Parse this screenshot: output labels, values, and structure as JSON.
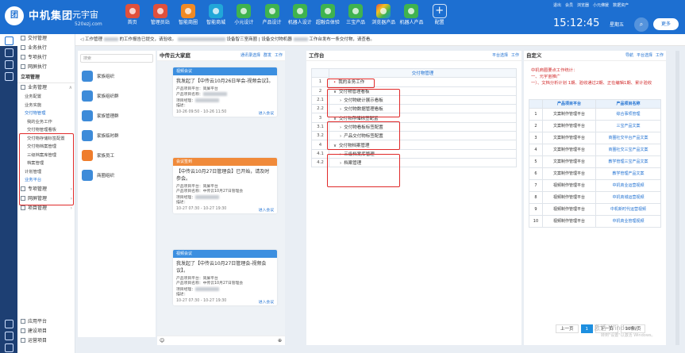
{
  "brand": {
    "logo_char": "团",
    "name": "中机集团",
    "product": "元宇宙",
    "site": "520ezj.com"
  },
  "nav": [
    {
      "label": "首页",
      "icon": "home-icon",
      "color": "red"
    },
    {
      "label": "管理员站",
      "icon": "admin-icon",
      "color": "red"
    },
    {
      "label": "智能商圈",
      "icon": "shop-icon",
      "color": "orange"
    },
    {
      "label": "智能商城",
      "icon": "cart-icon",
      "color": "cyan"
    },
    {
      "label": "小元设计",
      "icon": "design-icon",
      "color": "green"
    },
    {
      "label": "产品设计",
      "icon": "product-icon",
      "color": "green"
    },
    {
      "label": "机器人设计",
      "icon": "robot-icon",
      "color": "green"
    },
    {
      "label": "超融合体验",
      "icon": "fusion-icon",
      "color": "green"
    },
    {
      "label": "三宝产品",
      "icon": "product-icon",
      "color": "green"
    },
    {
      "label": "浏览器产品",
      "icon": "browser-icon",
      "color": "rainbow"
    },
    {
      "label": "机器人产品",
      "icon": "robot-icon",
      "color": "green"
    },
    {
      "label": "配置",
      "icon": "plus-icon",
      "color": "plus"
    }
  ],
  "top_links": [
    "退出",
    "会员",
    "浏览器",
    "小元佛媛",
    "数据资产"
  ],
  "clock": "15:12:45",
  "weekday": "星期五",
  "more": "更多",
  "notice": {
    "t1": "工作管理",
    "t2": "的工作报告已提交，请验收。",
    "t3": "设备智三室商圈 | 设备交付物机器",
    "t4": "工作台发布一条交付物，请查看。"
  },
  "sidebar": {
    "items_top": [
      {
        "label": "交付管理",
        "icon": "deliver-icon"
      },
      {
        "label": "业务执行",
        "icon": "task-icon"
      },
      {
        "label": "专项执行",
        "icon": "special-icon"
      },
      {
        "label": "网屏执行",
        "icon": "screen-icon"
      }
    ],
    "section": "立项管理",
    "group_label": "业务管理",
    "subs_a": [
      "业务配置",
      "业务实施"
    ],
    "deliver_group": "交付物管理",
    "deliver_subs": [
      "我的业务工作",
      "交付物管理看板",
      "交付物存储标签配置",
      "交付物档案管理",
      "三级档案库管理",
      "档案管理"
    ],
    "subs_b": [
      "计划管理",
      "业务平台"
    ],
    "items_mid": [
      {
        "label": "专项管理"
      },
      {
        "label": "网屏管理"
      },
      {
        "label": "项目管理"
      }
    ],
    "items_bottom": [
      {
        "label": "应用平台"
      },
      {
        "label": "建设项目"
      },
      {
        "label": "运营项目"
      }
    ]
  },
  "contacts": {
    "search_placeholder": "搜索",
    "items": [
      {
        "name": "家族组织",
        "c": "b"
      },
      {
        "name": "家族组织群",
        "c": "b"
      },
      {
        "name": "家族管理群",
        "c": "b"
      },
      {
        "name": "家族临时群",
        "c": "b"
      },
      {
        "name": "家族员工",
        "c": "o"
      },
      {
        "name": "商圈组织",
        "c": "b"
      }
    ]
  },
  "chat": {
    "title": "中传云大家庭",
    "tools": [
      "通讯录选择",
      "群发",
      "工作"
    ],
    "cards": [
      {
        "type": "视频会议",
        "text": "我发起了【中传云10月26日早会-视频会议】。",
        "p1": "产品项目平台：",
        "p1v": "简屏平台",
        "p2": "产品项目名称：",
        "p2v": "",
        "p3": "项目经理：",
        "p3v": "",
        "p4": "描述：",
        "time": "10-26 09:50 - 10-26 11:50",
        "link": "进入会议",
        "color": "blue"
      },
      {
        "type": "会议签到",
        "text": "【中传云10月27日管理会】已开始，请及时参会。",
        "p1": "产品项目平台：",
        "p1v": "简屏平台",
        "p2": "产品项目名称：",
        "p2v": "中传云10月27日管理会",
        "p3": "项目经理：",
        "p3v": "",
        "p4": "描述：",
        "time": "10-27 07:30 - 10-27 19:30",
        "link": "进入会议",
        "color": "orange"
      },
      {
        "type": "视频会议",
        "text": "我发起了【中传云10月27日管理会-视频会议】。",
        "p1": "产品项目平台：",
        "p1v": "简屏平台",
        "p2": "产品项目名称：",
        "p2v": "中传云10月27日管理会",
        "p3": "项目经理：",
        "p3v": "",
        "p4": "描述：",
        "time": "10-27 07:30 - 10-27 19:30",
        "link": "进入会议",
        "color": "blue"
      }
    ]
  },
  "workbench": {
    "title": "工作台",
    "tools": [
      "平台选择",
      "工作"
    ],
    "col_header": "交付物管理",
    "rows": [
      {
        "num": "1",
        "text": "我的业务工作",
        "lv": 1,
        "mark": "•"
      },
      {
        "num": "2",
        "text": "交付物管理看板",
        "lv": 1,
        "mark": "∨"
      },
      {
        "num": "2.1",
        "text": "交付物统计展示看板",
        "lv": 2,
        "mark": "›"
      },
      {
        "num": "2.2",
        "text": "交付物数据管理看板",
        "lv": 2,
        "mark": "›"
      },
      {
        "num": "3",
        "text": "交付物存储标签配置",
        "lv": 1,
        "mark": "∨"
      },
      {
        "num": "3.1",
        "text": "交付物看板标签配置",
        "lv": 2,
        "mark": "›"
      },
      {
        "num": "3.2",
        "text": "产品交付物标签配置",
        "lv": 2,
        "mark": "›"
      },
      {
        "num": "4",
        "text": "交付物档案管理",
        "lv": 1,
        "mark": "∨"
      },
      {
        "num": "4.1",
        "text": "三级档案库管理",
        "lv": 2,
        "mark": "›"
      },
      {
        "num": "4.2",
        "text": "档案管理",
        "lv": 2,
        "mark": "›"
      }
    ]
  },
  "custom": {
    "title": "自定义",
    "tools": [
      "导航",
      "平台选择",
      "工作"
    ],
    "stats": [
      "中机商圈要点工作统计：",
      "一、元宇宙推广",
      "一）、文档分析计划 1期、验收通过2期、正在编辑1期、累计验收"
    ],
    "head": [
      "产品项目平台",
      "产品项目名称"
    ],
    "rows": [
      {
        "n": "1",
        "a": "文案制作管理平台",
        "b": "综合事项管理"
      },
      {
        "n": "2",
        "a": "文案制作管理平台",
        "b": "三宝产品文案"
      },
      {
        "n": "3",
        "a": "文案制作管理平台",
        "b": "商圈社交平台产品文案"
      },
      {
        "n": "4",
        "a": "文案制作管理平台",
        "b": "商圈社交三宝产品文案"
      },
      {
        "n": "5",
        "a": "文案制作管理平台",
        "b": "教学管理三宝产品文案"
      },
      {
        "n": "6",
        "a": "文案制作管理平台",
        "b": "教学管理产品文案"
      },
      {
        "n": "7",
        "a": "视频制作管理平台",
        "b": "中机商业运营视频"
      },
      {
        "n": "8",
        "a": "视频制作管理平台",
        "b": "中机商城运营视频"
      },
      {
        "n": "9",
        "a": "视频制作管理平台",
        "b": "中机新时代运营视频"
      },
      {
        "n": "10",
        "a": "视频制作管理平台",
        "b": "中机商业管理视频"
      }
    ],
    "pager": {
      "prev": "上一页",
      "cur": "1",
      "next": "下一页",
      "size": "10条/页"
    }
  },
  "watermark": {
    "line1": "激活 Windows",
    "line2": "转到\"设置\"以激活 Windows。"
  }
}
